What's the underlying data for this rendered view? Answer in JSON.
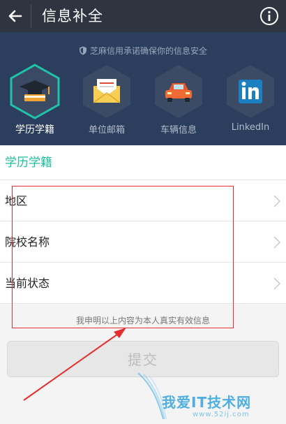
{
  "header": {
    "title": "信息补全"
  },
  "hero": {
    "secure_text": "芝麻信用承诺确保你的信息安全",
    "categories": [
      {
        "label": "学历学籍",
        "icon": "graduation-cap-icon",
        "active": true
      },
      {
        "label": "单位邮箱",
        "icon": "envelope-icon",
        "active": false
      },
      {
        "label": "车辆信息",
        "icon": "car-icon",
        "active": false
      },
      {
        "label": "LinkedIn",
        "icon": "linkedin-icon",
        "active": false
      }
    ]
  },
  "form": {
    "section_title": "学历学籍",
    "rows": [
      {
        "label": "地区"
      },
      {
        "label": "院校名称"
      },
      {
        "label": "当前状态"
      }
    ],
    "declaration": "我申明以上内容为本人真实有效信息",
    "submit_label": "提交"
  },
  "watermark": {
    "line1": "我爱IT技术网",
    "line2": "www.52ij.com"
  },
  "colors": {
    "nav_bg": "#2f3540",
    "hero_bg": "#2c3e5e",
    "accent": "#1fbf9d",
    "annotation": "#e3302e"
  }
}
